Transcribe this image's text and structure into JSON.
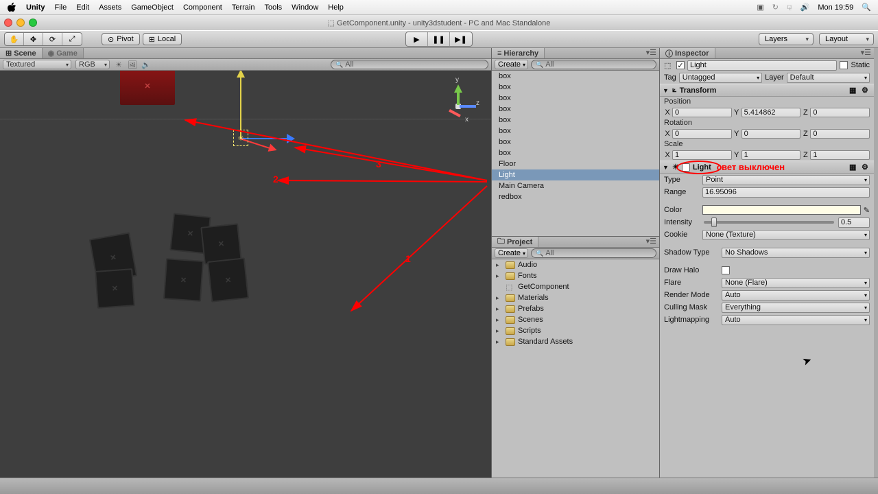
{
  "mac": {
    "brand": "Unity",
    "menu": [
      "File",
      "Edit",
      "Assets",
      "GameObject",
      "Component",
      "Terrain",
      "Tools",
      "Window",
      "Help"
    ],
    "clock": "Mon 19:59"
  },
  "window": {
    "title": "GetComponent.unity - unity3dstudent - PC and Mac Standalone"
  },
  "toolbar": {
    "pivot": "Pivot",
    "local": "Local",
    "layers": "Layers",
    "layout": "Layout"
  },
  "scene": {
    "tab_scene": "Scene",
    "tab_game": "Game",
    "shaded": "Textured",
    "render": "RGB",
    "search_placeholder": "All"
  },
  "hierarchy": {
    "label": "Hierarchy",
    "create": "Create",
    "search_placeholder": "All",
    "items": [
      "box",
      "box",
      "box",
      "box",
      "box",
      "box",
      "box",
      "box",
      "Floor",
      "Light",
      "Main Camera",
      "redbox"
    ],
    "selected_index": 9
  },
  "project": {
    "label": "Project",
    "create": "Create",
    "search_placeholder": "All",
    "items": [
      {
        "name": "Audio",
        "type": "folder",
        "fold": true
      },
      {
        "name": "Fonts",
        "type": "folder",
        "fold": true
      },
      {
        "name": "GetComponent",
        "type": "script",
        "fold": false
      },
      {
        "name": "Materials",
        "type": "folder",
        "fold": true
      },
      {
        "name": "Prefabs",
        "type": "folder",
        "fold": true
      },
      {
        "name": "Scenes",
        "type": "folder",
        "fold": true
      },
      {
        "name": "Scripts",
        "type": "folder",
        "fold": true
      },
      {
        "name": "Standard Assets",
        "type": "folder",
        "fold": true
      }
    ]
  },
  "inspector": {
    "label": "Inspector",
    "object_name": "Light",
    "static": "Static",
    "tag_label": "Tag",
    "tag": "Untagged",
    "layer_label": "Layer",
    "layer": "Default",
    "transform": {
      "title": "Transform",
      "pos_label": "Position",
      "px": "0",
      "py": "5.414862",
      "pz": "0",
      "rot_label": "Rotation",
      "rx": "0",
      "ry": "0",
      "rz": "0",
      "scl_label": "Scale",
      "sx": "1",
      "sy": "1",
      "sz": "1"
    },
    "light": {
      "title": "Light",
      "annotation": "свет выключен",
      "type_label": "Type",
      "type": "Point",
      "range_label": "Range",
      "range": "16.95096",
      "color_label": "Color",
      "intensity_label": "Intensity",
      "intensity": "0.5",
      "cookie_label": "Cookie",
      "cookie": "None (Texture)",
      "shadow_label": "Shadow Type",
      "shadow": "No Shadows",
      "halo_label": "Draw Halo",
      "flare_label": "Flare",
      "flare": "None (Flare)",
      "render_label": "Render Mode",
      "render": "Auto",
      "mask_label": "Culling Mask",
      "mask": "Everything",
      "lightmap_label": "Lightmapping",
      "lightmap": "Auto"
    }
  },
  "annotations": {
    "n1": "1",
    "n2": "2",
    "n3": "3"
  },
  "gizmo": {
    "x": "x",
    "y": "y",
    "z": "z"
  }
}
